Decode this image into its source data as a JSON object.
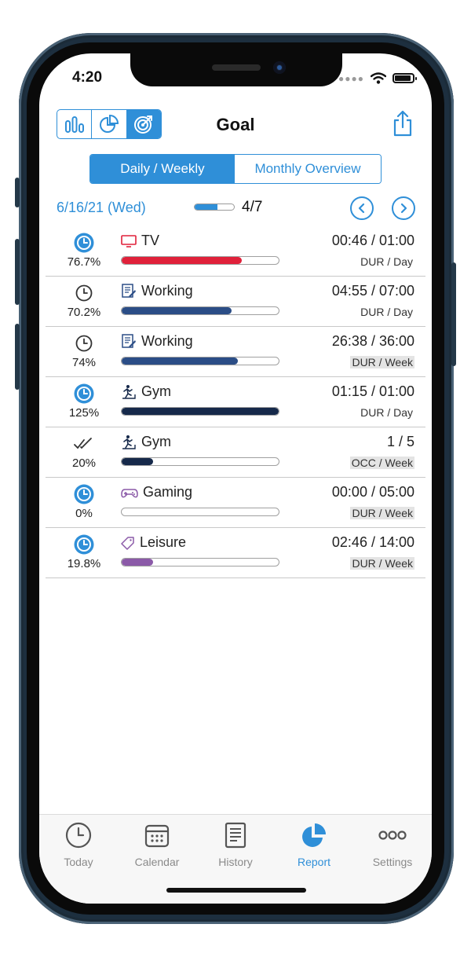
{
  "status": {
    "time": "4:20"
  },
  "header": {
    "title": "Goal",
    "view_icons": [
      "bar-chart-icon",
      "pie-chart-icon",
      "target-icon"
    ],
    "share_icon": "share-icon"
  },
  "range_tabs": {
    "daily": "Daily / Weekly",
    "monthly": "Monthly Overview"
  },
  "date_row": {
    "date": "6/16/21 (Wed)",
    "count": "4/7",
    "progress": 0.57
  },
  "goals": [
    {
      "icon": "clock-filled-icon",
      "pct": "76.7%",
      "cat_icon": "tv-icon",
      "name": "TV",
      "value": "00:46 / 01:00",
      "unit": "DUR / Day",
      "unit_shaded": false,
      "progress": 0.767,
      "color": "#e0213a"
    },
    {
      "icon": "clock-outline-icon",
      "pct": "70.2%",
      "cat_icon": "notes-icon",
      "name": "Working",
      "value": "04:55 / 07:00",
      "unit": "DUR / Day",
      "unit_shaded": false,
      "progress": 0.702,
      "color": "#2b4d86"
    },
    {
      "icon": "clock-outline-icon",
      "pct": "74%",
      "cat_icon": "notes-icon",
      "name": "Working",
      "value": "26:38 / 36:00",
      "unit": "DUR / Week",
      "unit_shaded": true,
      "progress": 0.74,
      "color": "#2b4d86"
    },
    {
      "icon": "clock-filled-icon",
      "pct": "125%",
      "cat_icon": "gym-icon",
      "name": "Gym",
      "value": "01:15 / 01:00",
      "unit": "DUR / Day",
      "unit_shaded": false,
      "progress": 1.0,
      "color": "#16294a"
    },
    {
      "icon": "double-check-icon",
      "pct": "20%",
      "cat_icon": "gym-icon",
      "name": "Gym",
      "value": "1 / 5",
      "unit": "OCC / Week",
      "unit_shaded": true,
      "progress": 0.2,
      "color": "#16294a"
    },
    {
      "icon": "clock-filled-icon",
      "pct": "0%",
      "cat_icon": "gamepad-icon",
      "name": "Gaming",
      "value": "00:00 / 05:00",
      "unit": "DUR / Week",
      "unit_shaded": true,
      "progress": 0.0,
      "color": "#8b5aa8"
    },
    {
      "icon": "clock-filled-icon",
      "pct": "19.8%",
      "cat_icon": "tag-icon",
      "name": "Leisure",
      "value": "02:46 / 14:00",
      "unit": "DUR / Week",
      "unit_shaded": true,
      "progress": 0.198,
      "color": "#8b5aa8"
    }
  ],
  "tabs": [
    {
      "label": "Today",
      "icon": "clock-tab-icon",
      "active": false
    },
    {
      "label": "Calendar",
      "icon": "calendar-icon",
      "active": false
    },
    {
      "label": "History",
      "icon": "history-icon",
      "active": false
    },
    {
      "label": "Report",
      "icon": "report-pie-icon",
      "active": true
    },
    {
      "label": "Settings",
      "icon": "more-icon",
      "active": false
    }
  ],
  "colors": {
    "accent": "#2f8fd8",
    "tv": "#e0213a",
    "work": "#2b4d86",
    "gym": "#16294a",
    "fun": "#8b5aa8"
  }
}
